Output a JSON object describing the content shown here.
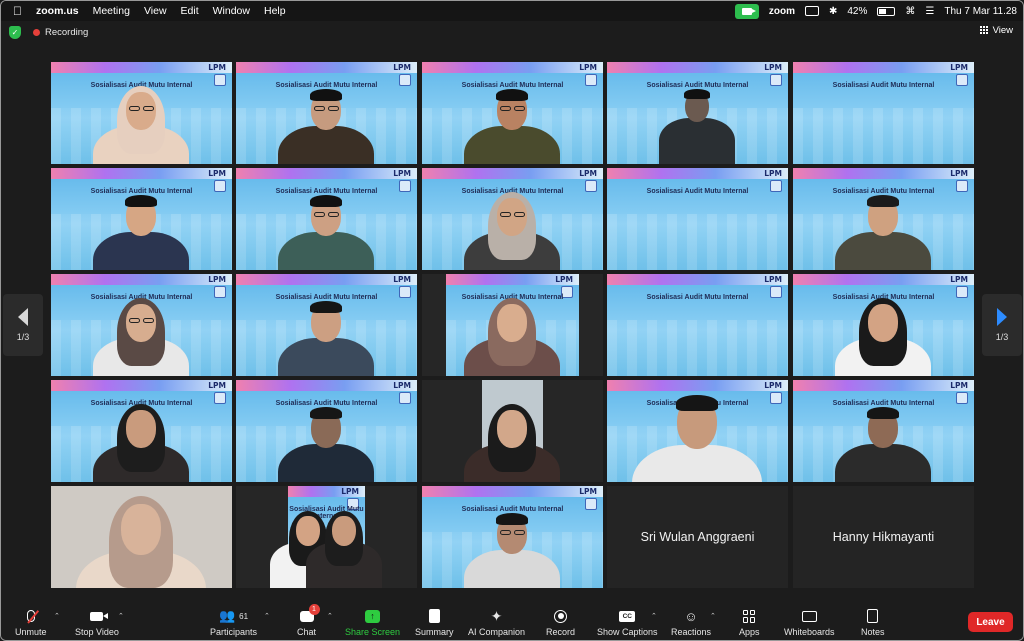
{
  "menubar": {
    "app": "zoom.us",
    "items": [
      "Meeting",
      "View",
      "Edit",
      "Window",
      "Help"
    ],
    "zoom_label": "zoom",
    "battery": "42%",
    "datetime": "Thu 7 Mar  11.28"
  },
  "status": {
    "recording_label": "Recording",
    "view_label": "View"
  },
  "banner": {
    "title": "Sosialisasi Audit Mutu Internal",
    "brand": "LPM"
  },
  "names": {
    "sri": "Sri Wulan Anggraeni",
    "hanny": "Hanny Hikmayanti"
  },
  "pager": {
    "left": "1/3",
    "right": "1/3"
  },
  "toolbar": {
    "unmute": "Unmute",
    "stop_video": "Stop Video",
    "participants": "Participants",
    "participants_count": "61",
    "chat": "Chat",
    "chat_badge": "1",
    "share_screen": "Share Screen",
    "summary": "Summary",
    "ai_companion": "AI Companion",
    "record": "Record",
    "show_captions": "Show Captions",
    "reactions": "Reactions",
    "apps": "Apps",
    "whiteboards": "Whiteboards",
    "notes": "Notes",
    "leave": "Leave",
    "cc": "CC"
  },
  "colors": {
    "active_speaker": "#2ecc40",
    "leave": "#e02828",
    "share": "#2ecc40",
    "arrow_next": "#2d8cff"
  }
}
